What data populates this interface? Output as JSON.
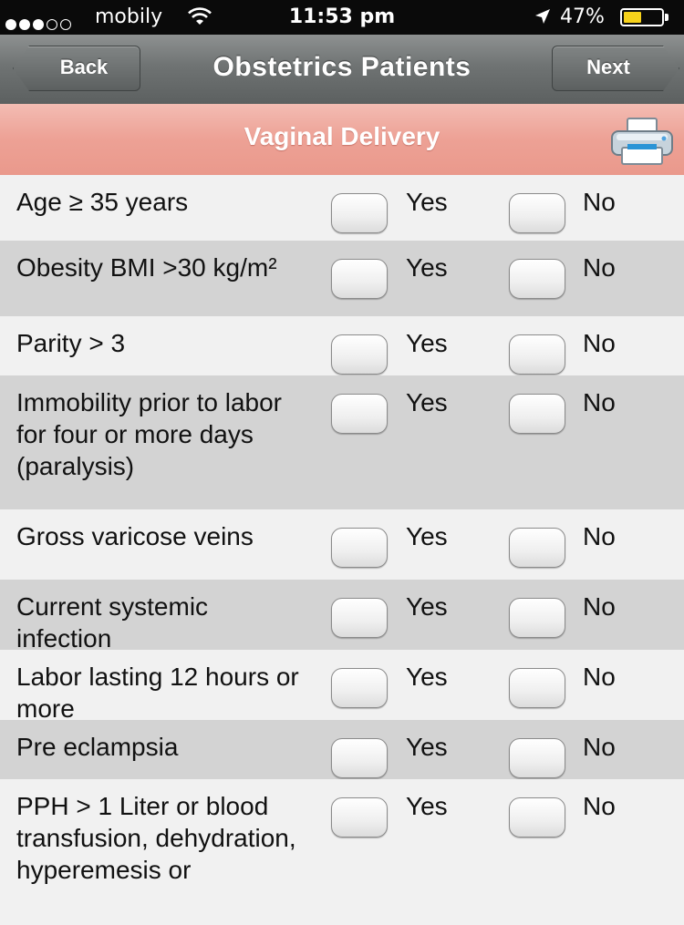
{
  "status_bar": {
    "carrier": "mobily",
    "time": "11:53 pm",
    "battery": "47%",
    "battery_level": 0.47,
    "signal_bars": 3,
    "signal_total": 5,
    "icons": [
      "wifi-icon",
      "location-arrow-icon",
      "battery-icon"
    ]
  },
  "nav": {
    "title": "Obstetrics Patients",
    "back_label": "Back",
    "next_label": "Next"
  },
  "section": {
    "title": "Vaginal Delivery",
    "print_icon": "printer-icon"
  },
  "options": {
    "yes_label": "Yes",
    "no_label": "No"
  },
  "rows": [
    {
      "label": "Age ≥ 35 years",
      "yes": false,
      "no": false
    },
    {
      "label": "Obesity BMI >30 kg/m²",
      "yes": false,
      "no": false
    },
    {
      "label": "Parity > 3",
      "yes": false,
      "no": false
    },
    {
      "label": "Immobility prior to labor for four or more days (paralysis)",
      "yes": false,
      "no": false
    },
    {
      "label": "Gross varicose veins",
      "yes": false,
      "no": false
    },
    {
      "label": "Current systemic infection",
      "yes": false,
      "no": false
    },
    {
      "label": "Labor lasting 12 hours or more",
      "yes": false,
      "no": false
    },
    {
      "label": "Pre eclampsia",
      "yes": false,
      "no": false
    },
    {
      "label": "PPH > 1 Liter or blood transfusion, dehydration, hyperemesis or",
      "yes": false,
      "no": false
    }
  ],
  "colors": {
    "nav_bar": "#6f7373",
    "section_header": "#eda195",
    "row_light": "#f1f1f1",
    "row_dark": "#d3d3d3",
    "battery_fill": "#f7d21b"
  }
}
